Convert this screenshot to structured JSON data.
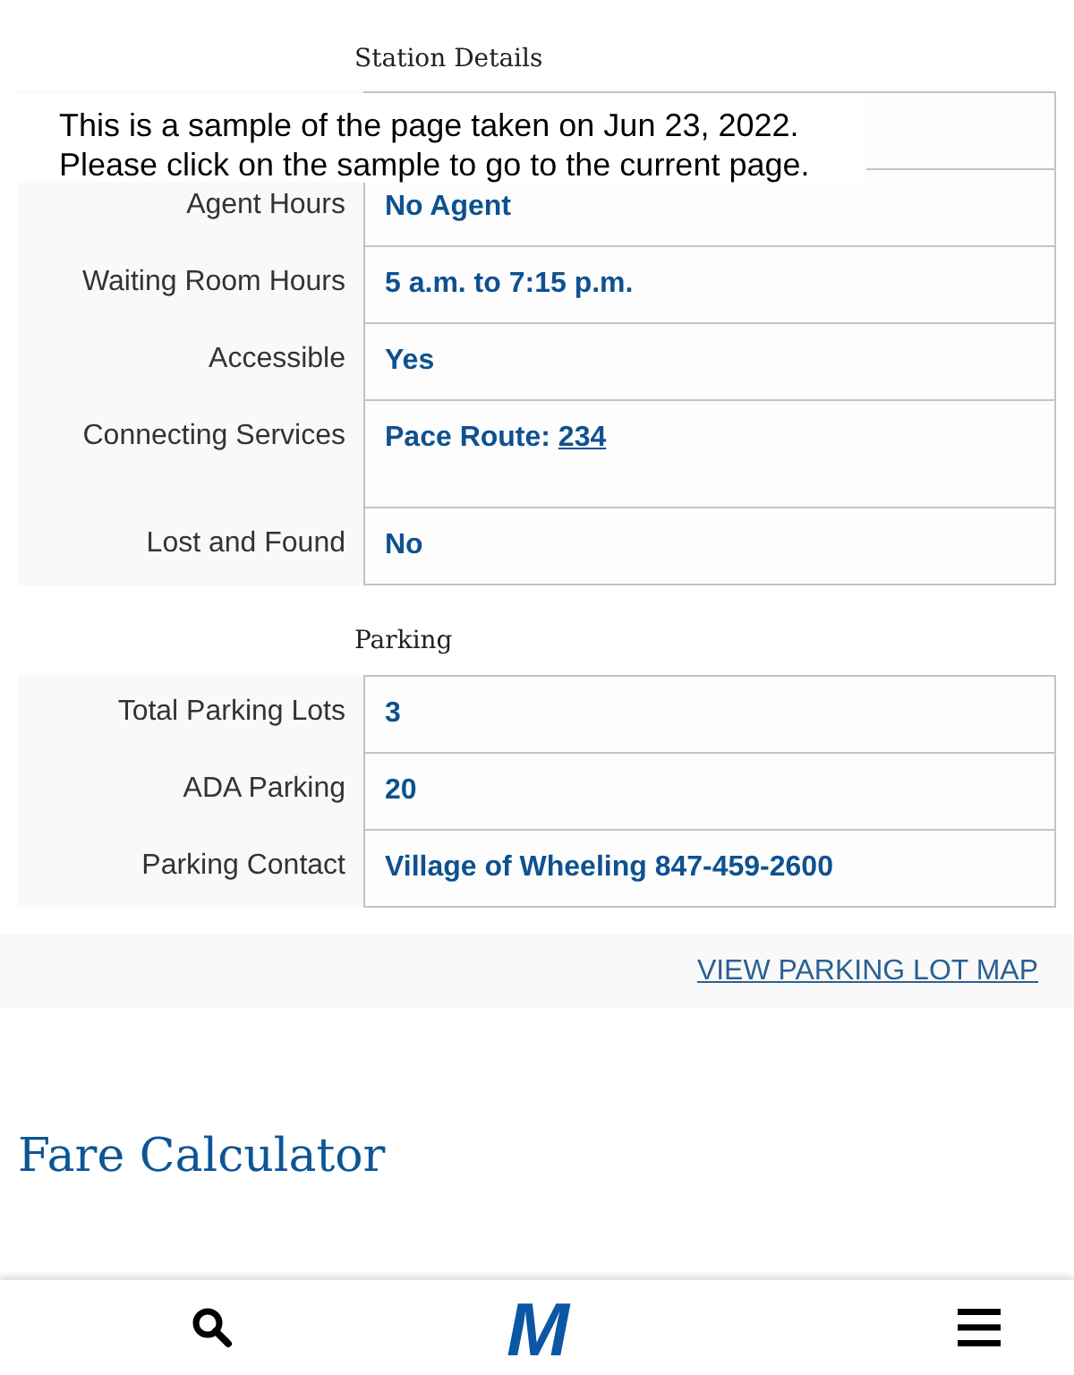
{
  "notice": {
    "lines": [
      "This is a sample of the page taken on Jun 23, 2022.",
      "Please click on the sample to go to the current page."
    ]
  },
  "sections": [
    {
      "heading": "Station Details",
      "rows": [
        {
          "kind": "text",
          "label": "Agent Hours",
          "value": "No Agent"
        },
        {
          "kind": "text",
          "label": "Waiting Room Hours",
          "value": "5 a.m. to 7:15 p.m."
        },
        {
          "kind": "text",
          "label": "Accessible",
          "value": "Yes"
        },
        {
          "kind": "link",
          "label": "Connecting Services",
          "value": "Pace Route:",
          "link": "234"
        },
        {
          "kind": "text",
          "label": "Lost and Found",
          "value": "No"
        }
      ]
    },
    {
      "heading": "Parking",
      "rows": [
        {
          "kind": "text",
          "label": "Total Parking Lots",
          "value": "3"
        },
        {
          "kind": "text",
          "label": "ADA Parking",
          "value": "20"
        },
        {
          "kind": "text",
          "label": "Parking Contact",
          "value": "Village of Wheeling 847-459-2600"
        }
      ]
    }
  ],
  "map_link": "VIEW PARKING LOT MAP",
  "fare_heading": "Fare Calculator",
  "bottom_nav": {
    "items": [
      {
        "kind": "search"
      },
      {
        "kind": "logo",
        "text": "M"
      },
      {
        "kind": "menu"
      }
    ]
  }
}
